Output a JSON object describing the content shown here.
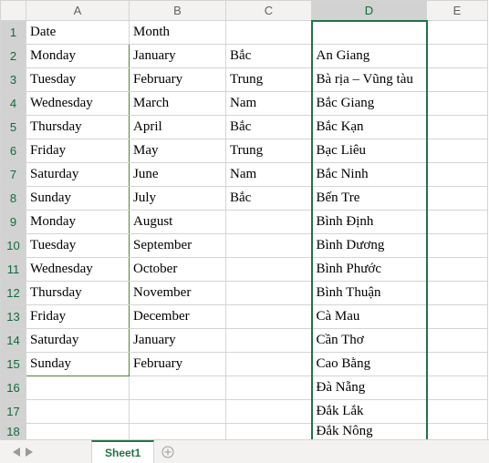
{
  "columns": {
    "rowhdr": "",
    "A": "A",
    "B": "B",
    "C": "C",
    "D": "D",
    "E": "E"
  },
  "rows": {
    "1": {
      "hdr": "1",
      "A": "Date",
      "B": "Month",
      "C": "",
      "D": "",
      "E": ""
    },
    "2": {
      "hdr": "2",
      "A": "Monday",
      "B": "January",
      "C": "Bắc",
      "D": "An Giang",
      "E": ""
    },
    "3": {
      "hdr": "3",
      "A": "Tuesday",
      "B": "February",
      "C": "Trung",
      "D": "Bà rịa – Vũng tàu",
      "E": ""
    },
    "4": {
      "hdr": "4",
      "A": "Wednesday",
      "B": "March",
      "C": "Nam",
      "D": "Bắc Giang",
      "E": ""
    },
    "5": {
      "hdr": "5",
      "A": "Thursday",
      "B": "April",
      "C": "Bắc",
      "D": "Bắc Kạn",
      "E": ""
    },
    "6": {
      "hdr": "6",
      "A": "Friday",
      "B": "May",
      "C": "Trung",
      "D": "Bạc Liêu",
      "E": ""
    },
    "7": {
      "hdr": "7",
      "A": "Saturday",
      "B": "June",
      "C": "Nam",
      "D": "Bắc Ninh",
      "E": ""
    },
    "8": {
      "hdr": "8",
      "A": "Sunday",
      "B": "July",
      "C": "Bắc",
      "D": "Bến Tre",
      "E": ""
    },
    "9": {
      "hdr": "9",
      "A": "Monday",
      "B": "August",
      "C": "",
      "D": "Bình Định",
      "E": ""
    },
    "10": {
      "hdr": "10",
      "A": "Tuesday",
      "B": "September",
      "C": "",
      "D": "Bình Dương",
      "E": ""
    },
    "11": {
      "hdr": "11",
      "A": "Wednesday",
      "B": "October",
      "C": "",
      "D": "Bình Phước",
      "E": ""
    },
    "12": {
      "hdr": "12",
      "A": "Thursday",
      "B": "November",
      "C": "",
      "D": "Bình Thuận",
      "E": ""
    },
    "13": {
      "hdr": "13",
      "A": "Friday",
      "B": "December",
      "C": "",
      "D": "Cà Mau",
      "E": ""
    },
    "14": {
      "hdr": "14",
      "A": "Saturday",
      "B": "January",
      "C": "",
      "D": "Cần Thơ",
      "E": ""
    },
    "15": {
      "hdr": "15",
      "A": "Sunday",
      "B": "February",
      "C": "",
      "D": "Cao Bằng",
      "E": ""
    },
    "16": {
      "hdr": "16",
      "A": "",
      "B": "",
      "C": "",
      "D": "Đà Nẵng",
      "E": ""
    },
    "17": {
      "hdr": "17",
      "A": "",
      "B": "",
      "C": "",
      "D": "Đắk Lắk",
      "E": ""
    },
    "18": {
      "hdr": "18",
      "A": "",
      "B": "",
      "C": "",
      "D": "Đắk Nông",
      "E": ""
    }
  },
  "tabs": {
    "active": "Sheet1"
  }
}
